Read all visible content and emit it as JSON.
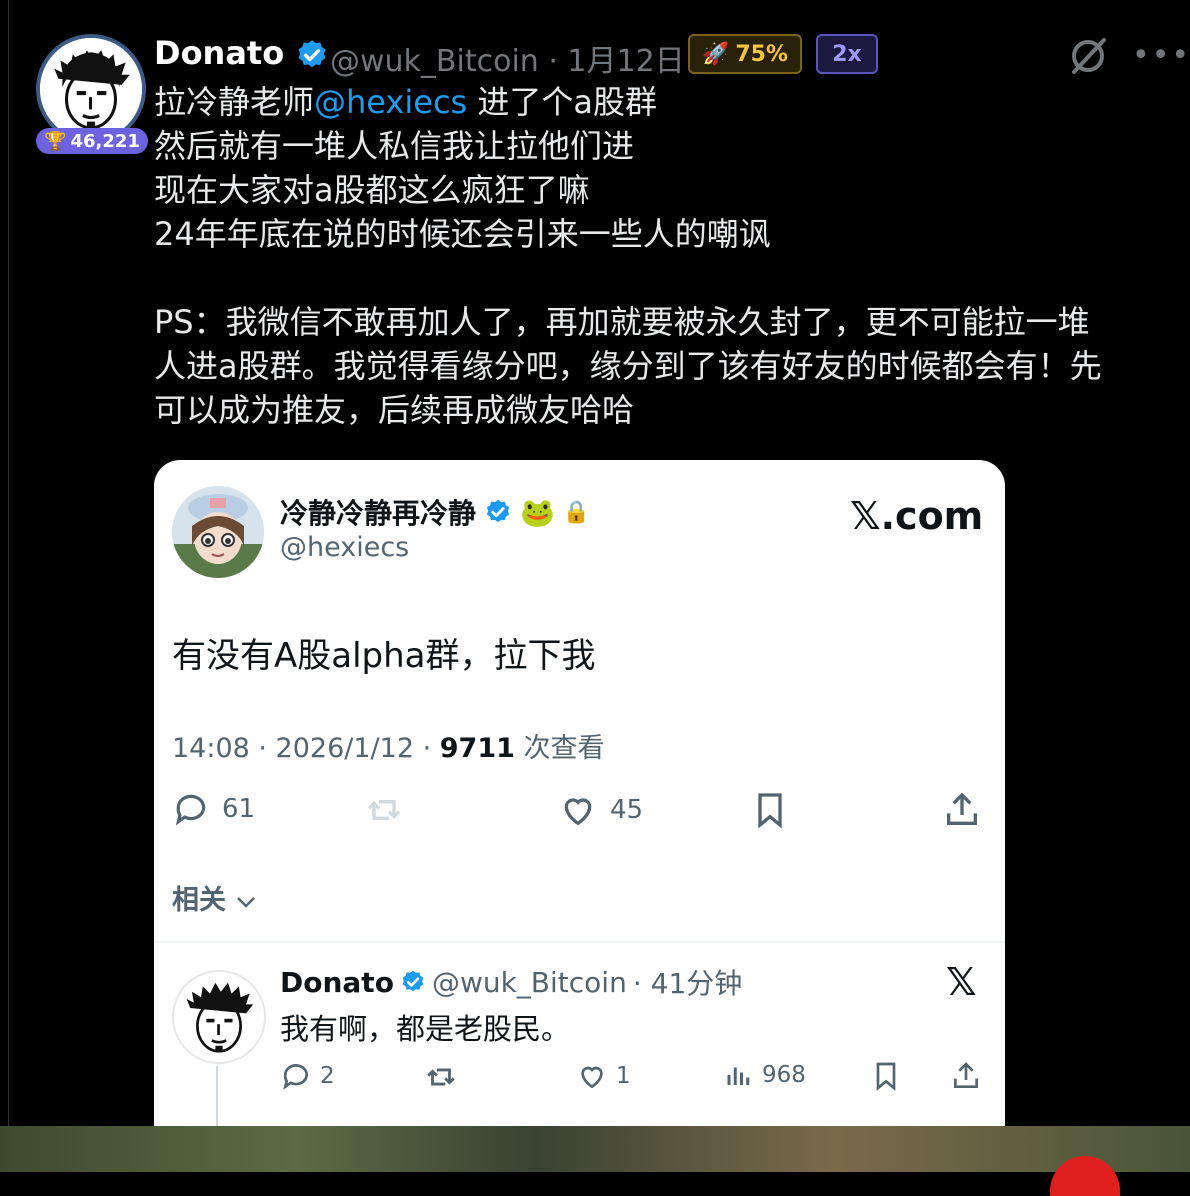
{
  "author": {
    "name": "Donato",
    "handle": "@wuk_Bitcoin",
    "date": "· 1月12日",
    "rank_count": "46,221",
    "rank_emoji": "🏆"
  },
  "badges": {
    "rocket_emoji": "🚀",
    "rocket_value": "75%",
    "multiplier": "2x"
  },
  "icons": {
    "verified": "verified-badge-icon",
    "grok": "grok-icon",
    "more": "more-icon"
  },
  "tweet": {
    "line1_a": "拉冷静老师",
    "line1_mention": "@hexiecs",
    "line1_b": " 进了个a股群",
    "line2": "然后就有一堆人私信我让拉他们进",
    "line3": "现在大家对a股都这么疯狂了嘛",
    "line4": "24年年底在说的时候还会引来一些人的嘲讽",
    "line5": "PS：我微信不敢再加人了，再加就要被永久封了，更不可能拉一堆",
    "line6": "人进a股群。我觉得看缘分吧，缘分到了该有好友的时候都会有！先",
    "line7": "可以成为推友，后续再成微友哈哈"
  },
  "quoted": {
    "name": "冷静冷静再冷静",
    "handle": "@hexiecs",
    "source": "𝕏.com",
    "frog_emoji": "🐸",
    "lock_emoji": "🔒",
    "text": "有没有A股alpha群，拉下我",
    "meta_time": "14:08 · 2026/1/12 · ",
    "meta_views": "9711",
    "meta_views_label": " 次查看",
    "replies": "61",
    "likes": "45",
    "related": "相关"
  },
  "reply": {
    "name": "Donato",
    "handle": "@wuk_Bitcoin",
    "time": "· 41分钟",
    "x_logo": "𝕏",
    "text": "我有啊，都是老股民。",
    "replies": "2",
    "likes": "1",
    "views": "968"
  },
  "colors": {
    "accent": "#1d9bf0",
    "badge_purple": "#6d63e0",
    "rocket_gold": "#f5c443",
    "multiplier_purple": "#9d97ff",
    "bottom_red": "#e0201e"
  }
}
